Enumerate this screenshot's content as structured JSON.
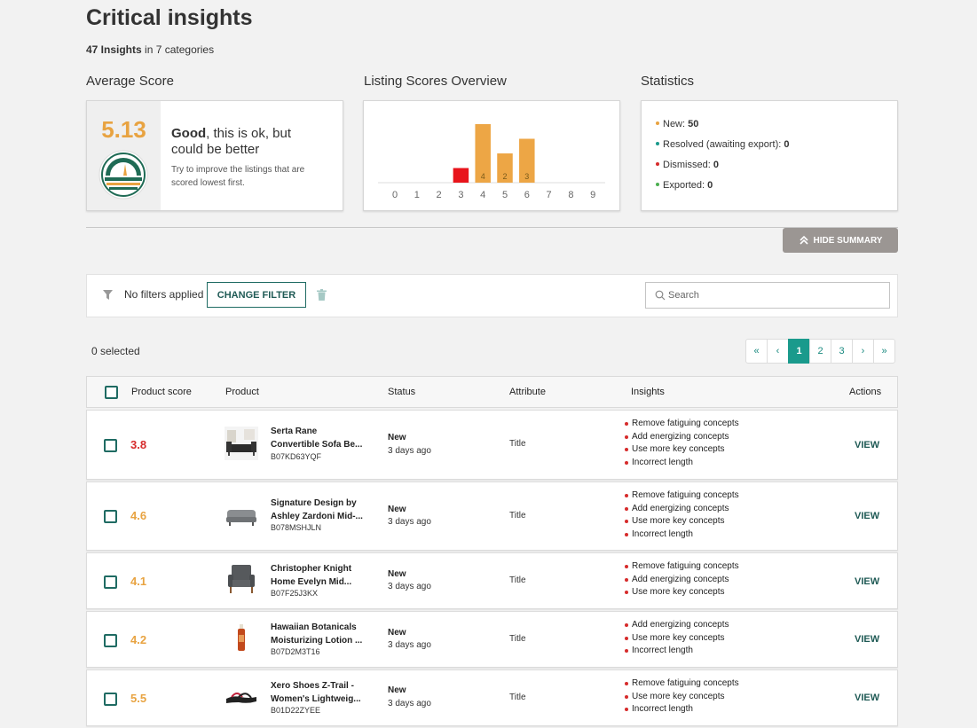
{
  "header": {
    "title": "Critical insights",
    "insights_count": "47 Insights",
    "insights_suffix": "in 7 categories"
  },
  "average_score": {
    "heading": "Average Score",
    "score": "5.13",
    "headline_bold": "Good",
    "headline_rest": ", this is ok, but could be better",
    "hint": "Try to improve the listings that are scored lowest first."
  },
  "listing_overview": {
    "heading": "Listing Scores Overview"
  },
  "statistics": {
    "heading": "Statistics",
    "items": [
      {
        "label": "New:",
        "value": "50",
        "color": "#e8a341"
      },
      {
        "label": "Resolved (awaiting export):",
        "value": "0",
        "color": "#1a9a8c"
      },
      {
        "label": "Dismissed:",
        "value": "0",
        "color": "#d62b2b"
      },
      {
        "label": "Exported:",
        "value": "0",
        "color": "#4caf50"
      }
    ]
  },
  "chart_data": {
    "type": "bar",
    "categories": [
      "0",
      "1",
      "2",
      "3",
      "4",
      "5",
      "6",
      "7",
      "8",
      "9"
    ],
    "values": [
      0,
      0,
      0,
      1,
      4,
      2,
      3,
      0,
      0,
      0
    ],
    "data_labels": [
      "",
      "",
      "",
      "",
      "4",
      "2",
      "3",
      "",
      "",
      ""
    ],
    "colors": [
      "#e8a341",
      "#e8a341",
      "#e8a341",
      "#e8141b",
      "#eda645",
      "#eda645",
      "#eda645",
      "#eda645",
      "#eda645",
      "#eda645"
    ],
    "title": "Listing Scores Overview",
    "ylim": [
      0,
      4
    ],
    "grid": false
  },
  "summary": {
    "hide_label": "HIDE SUMMARY"
  },
  "filters": {
    "status": "No filters applied",
    "change_label": "CHANGE FILTER",
    "search_placeholder": "Search"
  },
  "selection": {
    "label": "0 selected"
  },
  "pagination": {
    "first": "«",
    "prev": "‹",
    "pages": [
      "1",
      "2",
      "3"
    ],
    "active": "1",
    "next": "›",
    "last": "»"
  },
  "table": {
    "headers": {
      "score": "Product score",
      "product": "Product",
      "status": "Status",
      "attribute": "Attribute",
      "insights": "Insights",
      "actions": "Actions"
    },
    "rows": [
      {
        "score": "3.8",
        "score_color": "#d62b2b",
        "name1": "Serta Rane",
        "name2": "Convertible Sofa Be...",
        "asin": "B07KD63YQF",
        "status": "New",
        "time": "3 days ago",
        "attribute": "Title",
        "insights": [
          "Remove fatiguing concepts",
          "Add energizing concepts",
          "Use more key concepts",
          "Incorrect length"
        ],
        "action": "VIEW",
        "thumb": "sofa-bed-icon"
      },
      {
        "score": "4.6",
        "score_color": "#e8a341",
        "name1": "Signature Design by",
        "name2": "Ashley Zardoni Mid-...",
        "asin": "B078MSHJLN",
        "status": "New",
        "time": "3 days ago",
        "attribute": "Title",
        "insights": [
          "Remove fatiguing concepts",
          "Add energizing concepts",
          "Use more key concepts",
          "Incorrect length"
        ],
        "action": "VIEW",
        "thumb": "sofa-icon"
      },
      {
        "score": "4.1",
        "score_color": "#e8a341",
        "name1": "Christopher Knight",
        "name2": "Home Evelyn Mid...",
        "asin": "B07F25J3KX",
        "status": "New",
        "time": "3 days ago",
        "attribute": "Title",
        "insights": [
          "Remove fatiguing concepts",
          "Add energizing concepts",
          "Use more key concepts"
        ],
        "action": "VIEW",
        "thumb": "armchair-icon"
      },
      {
        "score": "4.2",
        "score_color": "#e8a341",
        "name1": "Hawaiian Botanicals",
        "name2": "Moisturizing Lotion ...",
        "asin": "B07D2M3T16",
        "status": "New",
        "time": "3 days ago",
        "attribute": "Title",
        "insights": [
          "Add energizing concepts",
          "Use more key concepts",
          "Incorrect length"
        ],
        "action": "VIEW",
        "thumb": "lotion-bottle-icon"
      },
      {
        "score": "5.5",
        "score_color": "#e8a341",
        "name1": "Xero Shoes Z-Trail -",
        "name2": "Women's Lightweig...",
        "asin": "B01D22ZYEE",
        "status": "New",
        "time": "3 days ago",
        "attribute": "Title",
        "insights": [
          "Remove fatiguing concepts",
          "Use more key concepts",
          "Incorrect length"
        ],
        "action": "VIEW",
        "thumb": "sandal-icon"
      }
    ]
  }
}
